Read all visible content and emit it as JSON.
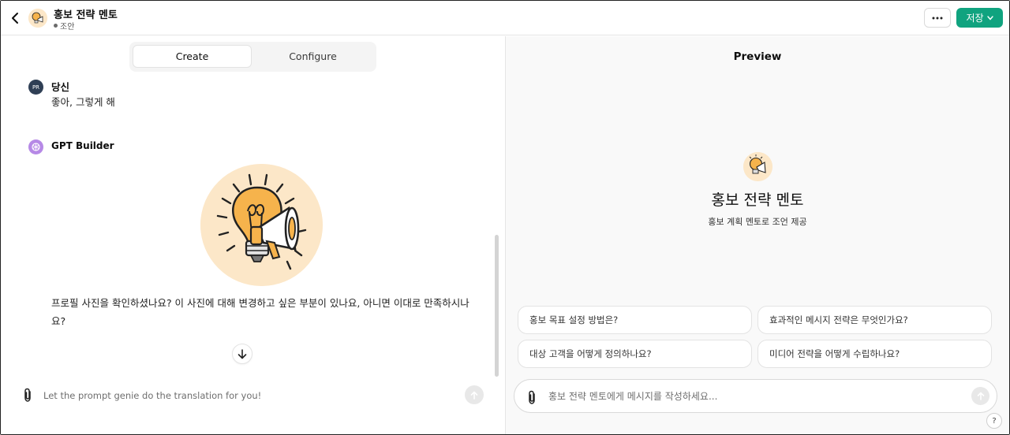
{
  "header": {
    "title": "홍보 전략 멘토",
    "status": "조안",
    "more_label": "···",
    "save_label": "저장"
  },
  "tabs": [
    {
      "label": "Create",
      "active": true
    },
    {
      "label": "Configure",
      "active": false
    }
  ],
  "conversation": {
    "user": {
      "avatar_initials": "PR",
      "name": "당신",
      "text": "좋아, 그렇게 해"
    },
    "assistant": {
      "name": "GPT Builder",
      "text": "프로필 사진을 확인하셨나요? 이 사진에 대해 변경하고 싶은 부분이 있나요, 아니면 이대로 만족하시나요?",
      "image_icon": "lightbulb-megaphone-icon"
    }
  },
  "composer": {
    "placeholder": "Let the prompt genie do the translation for you!"
  },
  "preview": {
    "title": "Preview",
    "gpt_name": "홍보 전략 멘토",
    "gpt_description": "홍보 계획 멘토로 조언 제공",
    "suggestions": [
      "홍보 목표 설정 방법은?",
      "효과적인 메시지 전략은 무엇인가요?",
      "대상 고객을 어떻게 정의하나요?",
      "미디어 전략을 어떻게 수립하나요?"
    ],
    "input_placeholder": "홍보 전략 멘토에게 메시지를 작성하세요...",
    "help_label": "?"
  },
  "colors": {
    "accent": "#10a37f",
    "gpt_builder_avatar": "#b689e6",
    "user_avatar": "#2f3f55",
    "avatar_bg": "#fce7c8"
  }
}
